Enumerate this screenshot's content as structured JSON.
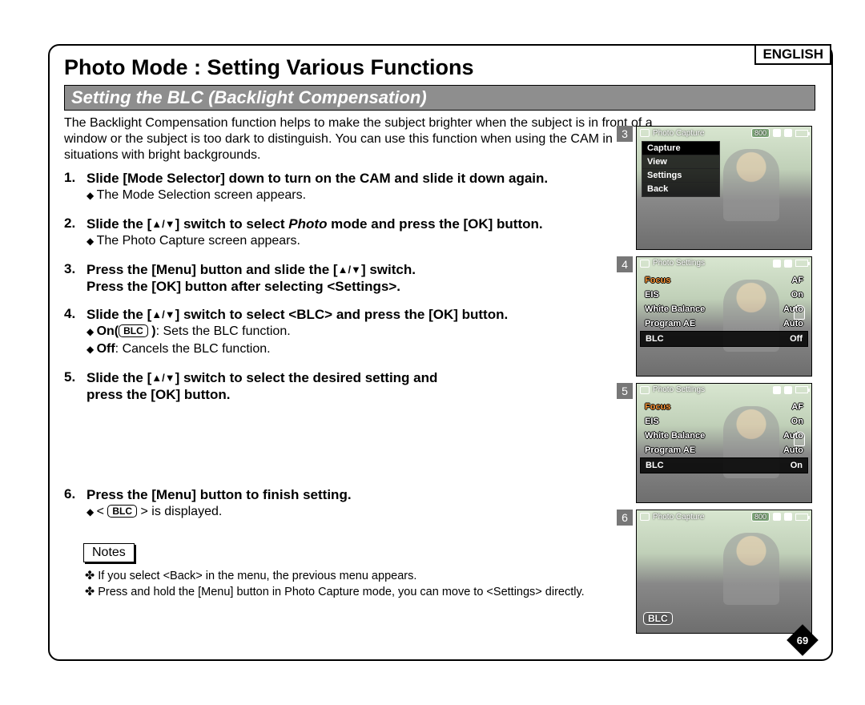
{
  "lang": "ENGLISH",
  "page_title": "Photo Mode : Setting Various Functions",
  "section_title": "Setting the BLC (Backlight Compensation)",
  "intro": "The Backlight Compensation function helps to make the subject brighter when the subject is in front of a window or the subject is too dark to distinguish. You can use this function when using the CAM in situations with bright backgrounds.",
  "steps": {
    "1": {
      "main": "Slide [Mode Selector] down to turn on the CAM and slide it down again.",
      "sub1": "The Mode Selection screen appears."
    },
    "2": {
      "main_a": "Slide the [",
      "tri": "▲/▼",
      "main_b": "] switch to select ",
      "em": "Photo",
      "main_c": " mode and press the [OK] button.",
      "sub1": "The Photo Capture screen appears."
    },
    "3": {
      "main_a": "Press the [Menu] button and slide the [",
      "tri": "▲/▼",
      "main_b": "] switch.",
      "main2": "Press the [OK] button after selecting <Settings>."
    },
    "4": {
      "main_a": "Slide the [",
      "tri": "▲/▼",
      "main_b": "] switch to select <BLC> and press the [OK] button.",
      "sub_on_a": "On(",
      "sub_on_b": " )",
      "sub_on_c": ": Sets the BLC function.",
      "sub_off": "Off",
      "sub_off_c": ": Cancels the BLC function."
    },
    "5": {
      "main_a": "Slide the [",
      "tri": "▲/▼",
      "main_b": "] switch to select the desired setting and",
      "main2": "press the [OK] button."
    },
    "6": {
      "main": "Press the [Menu] button to finish setting.",
      "sub_a": "< ",
      "sub_b": " > is displayed."
    }
  },
  "blc_pill": "BLC",
  "notes_label": "Notes",
  "notes": [
    "If you select <Back> in the menu, the previous menu appears.",
    "Press and hold the [Menu] button in Photo Capture mode, you can move to <Settings> directly."
  ],
  "page_number": "69",
  "shots": {
    "s3": {
      "num": "3",
      "title": "Photo Capture",
      "pill": "800",
      "menu": [
        "Capture",
        "View",
        "Settings",
        "Back"
      ]
    },
    "s4": {
      "num": "4",
      "title": "Photo Settings",
      "rows": [
        {
          "k": "Focus",
          "v": "AF",
          "focus": true
        },
        {
          "k": "EIS",
          "v": "On"
        },
        {
          "k": "White Balance",
          "v": "Auto"
        },
        {
          "k": "Program AE",
          "v": "Auto"
        },
        {
          "k": "BLC",
          "v": "Off",
          "sel": true
        }
      ]
    },
    "s5": {
      "num": "5",
      "title": "Photo Settings",
      "rows": [
        {
          "k": "Focus",
          "v": "AF",
          "focus": true
        },
        {
          "k": "EIS",
          "v": "On"
        },
        {
          "k": "White Balance",
          "v": "Auto"
        },
        {
          "k": "Program AE",
          "v": "Auto"
        },
        {
          "k": "BLC",
          "v": "On",
          "sel": true
        }
      ]
    },
    "s6": {
      "num": "6",
      "title": "Photo Capture",
      "pill": "800",
      "overlay": "BLC"
    }
  }
}
